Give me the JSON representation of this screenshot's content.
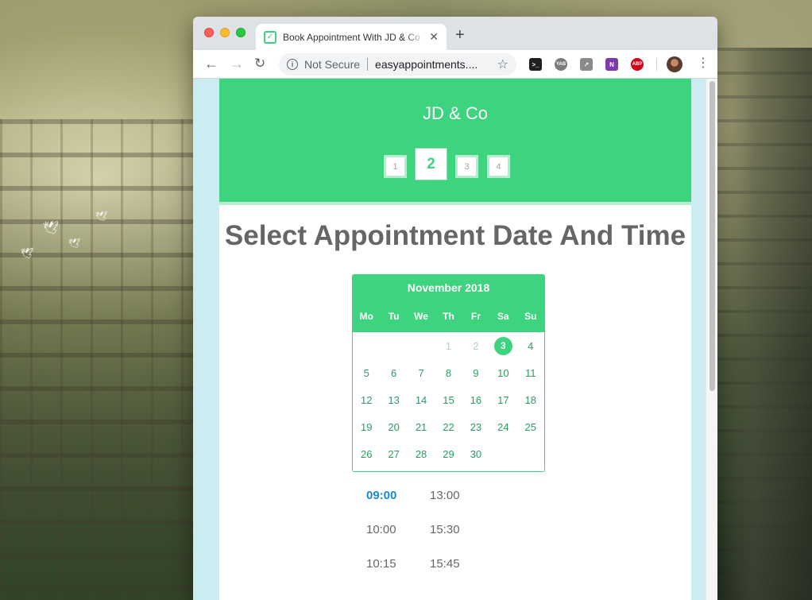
{
  "browser": {
    "tab_title": "Book Appointment With JD & Co",
    "favicon_glyph": "✓",
    "close_glyph": "✕",
    "new_tab_glyph": "+",
    "back_glyph": "←",
    "forward_glyph": "→",
    "reload_glyph": "↻",
    "info_glyph": "i",
    "security_label": "Not Secure",
    "url": "easyappointments....",
    "star_glyph": "☆",
    "menu_glyph": "⋮",
    "extensions": [
      {
        "name": "terminal-extension-icon",
        "label": ">_"
      },
      {
        "name": "yab-extension-icon",
        "label": "YAB"
      },
      {
        "name": "chart-extension-icon",
        "label": "↗"
      },
      {
        "name": "onenote-extension-icon",
        "label": "N"
      },
      {
        "name": "adblock-plus-extension-icon",
        "label": "ABP"
      }
    ]
  },
  "page": {
    "company_name": "JD & Co",
    "steps": [
      "1",
      "2",
      "3",
      "4"
    ],
    "active_step": "2",
    "title": "Select Appointment Date And Time"
  },
  "calendar": {
    "month_label": "November 2018",
    "weekdays": [
      "Mo",
      "Tu",
      "We",
      "Th",
      "Fr",
      "Sa",
      "Su"
    ],
    "selected_day": "3",
    "week1": [
      "",
      "",
      "",
      "1",
      "2",
      "3",
      "4"
    ],
    "week2": [
      "5",
      "6",
      "7",
      "8",
      "9",
      "10",
      "11"
    ],
    "week3": [
      "12",
      "13",
      "14",
      "15",
      "16",
      "17",
      "18"
    ],
    "week4": [
      "19",
      "20",
      "21",
      "22",
      "23",
      "24",
      "25"
    ],
    "week5": [
      "26",
      "27",
      "28",
      "29",
      "30",
      "",
      ""
    ]
  },
  "time_slots": {
    "left_column": [
      "09:00",
      "10:00",
      "10:15"
    ],
    "right_column": [
      "13:00",
      "15:30",
      "15:45"
    ],
    "selected": "09:00"
  },
  "colors": {
    "brand_green": "#3ed47f",
    "selected_time_blue": "#1a8ad0",
    "page_background": "#cbecf1"
  }
}
